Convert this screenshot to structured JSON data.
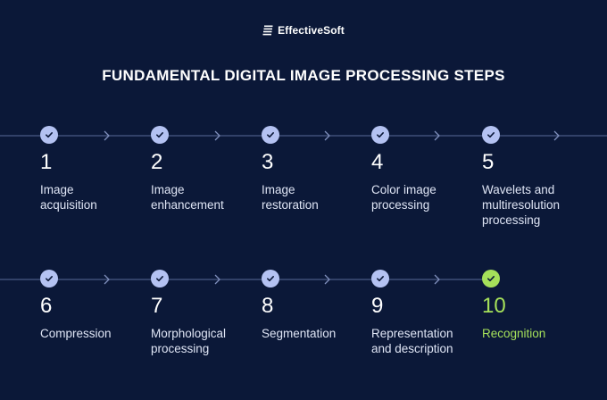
{
  "brand": {
    "name": "EffectiveSoft",
    "logo_icon": "stacked-lines-logo-icon"
  },
  "title": "FUNDAMENTAL DIGITAL IMAGE PROCESSING STEPS",
  "colors": {
    "background": "#0b1838",
    "check": "#b4c2f2",
    "accent": "#a5e05a",
    "line": "#5a6a99"
  },
  "rows": [
    {
      "steps": [
        {
          "number": "1",
          "label": "Image\nacquisition",
          "icon": "check-icon",
          "highlight": false
        },
        {
          "number": "2",
          "label": "Image\nenhancement",
          "icon": "check-icon",
          "highlight": false
        },
        {
          "number": "3",
          "label": "Image\nrestoration",
          "icon": "check-icon",
          "highlight": false
        },
        {
          "number": "4",
          "label": "Color image\nprocessing",
          "icon": "check-icon",
          "highlight": false
        },
        {
          "number": "5",
          "label": "Wavelets and\nmultiresolution\nprocessing",
          "icon": "check-icon",
          "highlight": false
        }
      ]
    },
    {
      "steps": [
        {
          "number": "6",
          "label": "Compression",
          "icon": "check-icon",
          "highlight": false
        },
        {
          "number": "7",
          "label": "Morphological\nprocessing",
          "icon": "check-icon",
          "highlight": false
        },
        {
          "number": "8",
          "label": "Segmentation",
          "icon": "check-icon",
          "highlight": false
        },
        {
          "number": "9",
          "label": "Representation\nand description",
          "icon": "check-icon",
          "highlight": false
        },
        {
          "number": "10",
          "label": "Recognition",
          "icon": "check-icon",
          "highlight": true
        }
      ]
    }
  ]
}
